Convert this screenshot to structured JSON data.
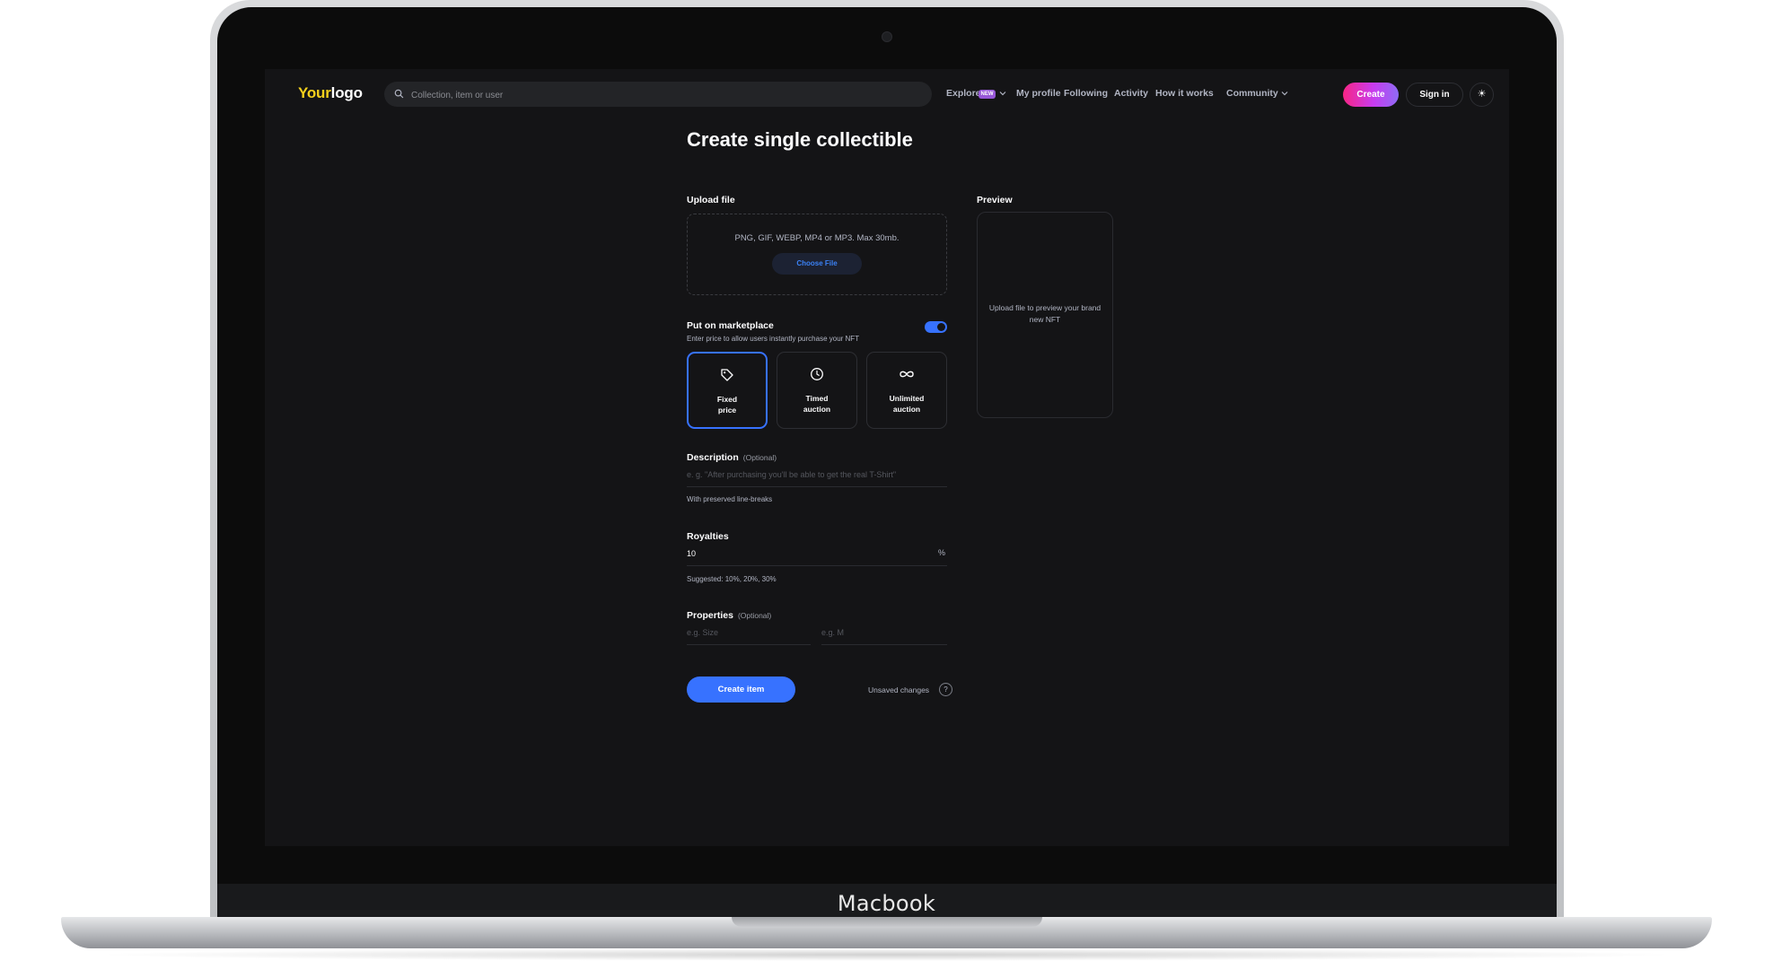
{
  "device": {
    "label": "Macbook"
  },
  "header": {
    "logo_part1": "Your",
    "logo_part2": "logo",
    "search_placeholder": "Collection, item or user",
    "nav": {
      "explore": "Explore",
      "explore_badge": "NEW",
      "my_profile": "My profile",
      "following": "Following",
      "activity": "Activity",
      "how_it_works": "How it works",
      "community": "Community"
    },
    "create_label": "Create",
    "signin_label": "Sign in",
    "theme_icon": "sun-icon"
  },
  "page": {
    "title": "Create single collectible",
    "upload": {
      "label": "Upload file",
      "hint": "PNG, GIF, WEBP, MP4 or MP3. Max 30mb.",
      "button": "Choose File"
    },
    "marketplace": {
      "label": "Put on marketplace",
      "subtext": "Enter price to allow users instantly purchase your NFT",
      "toggle_on": true,
      "options": [
        {
          "line1": "Fixed",
          "line2": "price",
          "icon": "tag-icon",
          "selected": true
        },
        {
          "line1": "Timed",
          "line2": "auction",
          "icon": "clock-icon",
          "selected": false
        },
        {
          "line1": "Unlimited",
          "line2": "auction",
          "icon": "infinity-icon",
          "selected": false
        }
      ]
    },
    "description": {
      "label": "Description",
      "optional": "(Optional)",
      "placeholder": "e. g. \"After purchasing you'll be able to get the real T-Shirt\"",
      "helper": "With preserved line-breaks"
    },
    "royalties": {
      "label": "Royalties",
      "value": "10",
      "unit": "%",
      "helper": "Suggested: 10%, 20%, 30%"
    },
    "properties": {
      "label": "Properties",
      "optional": "(Optional)",
      "size_placeholder": "e.g. Size",
      "value_placeholder": "e.g. M"
    },
    "actions": {
      "create_item": "Create item",
      "unsaved": "Unsaved changes",
      "help": "?"
    },
    "preview": {
      "label": "Preview",
      "empty_text": "Upload file to preview your brand new NFT"
    }
  },
  "colors": {
    "accent": "#3772ff",
    "background": "#141416",
    "logo_yellow": "#f4d01c",
    "create_gradient_start": "#f72585",
    "create_gradient_end": "#8e6bf5"
  }
}
